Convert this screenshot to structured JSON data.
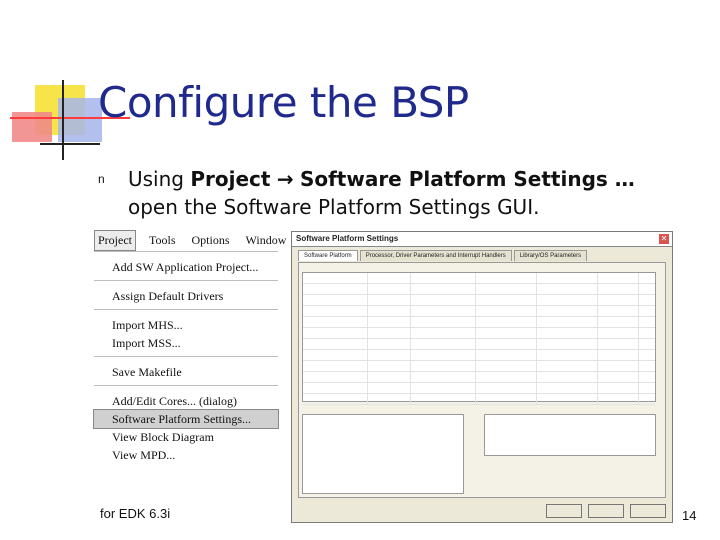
{
  "slide": {
    "title": "Configure the BSP",
    "bullet_marker": "n",
    "bullet": {
      "prefix": "Using ",
      "bold_project": "Project",
      "arrow": "→",
      "bold_rest": "Software Platform Settings …",
      "line2": "open the Software Platform Settings GUI."
    },
    "footer": "for EDK 6.3i",
    "page_number": "14"
  },
  "menu_shot": {
    "menubar": [
      "Project",
      "Tools",
      "Options",
      "Window"
    ],
    "groups": [
      [
        "Add SW Application Project..."
      ],
      [
        "Assign Default Drivers"
      ],
      [
        "Import MHS...",
        "Import MSS..."
      ],
      [
        "Save Makefile"
      ],
      [
        "Add/Edit Cores... (dialog)",
        "Software Platform Settings...",
        "View Block Diagram",
        "View MPD..."
      ]
    ]
  },
  "dialog": {
    "title": "Software Platform Settings",
    "close_glyph": "✕",
    "tabs": [
      "Software Platform",
      "Processor, Driver Parameters and Interrupt Handlers",
      "Library/OS Parameters"
    ]
  }
}
